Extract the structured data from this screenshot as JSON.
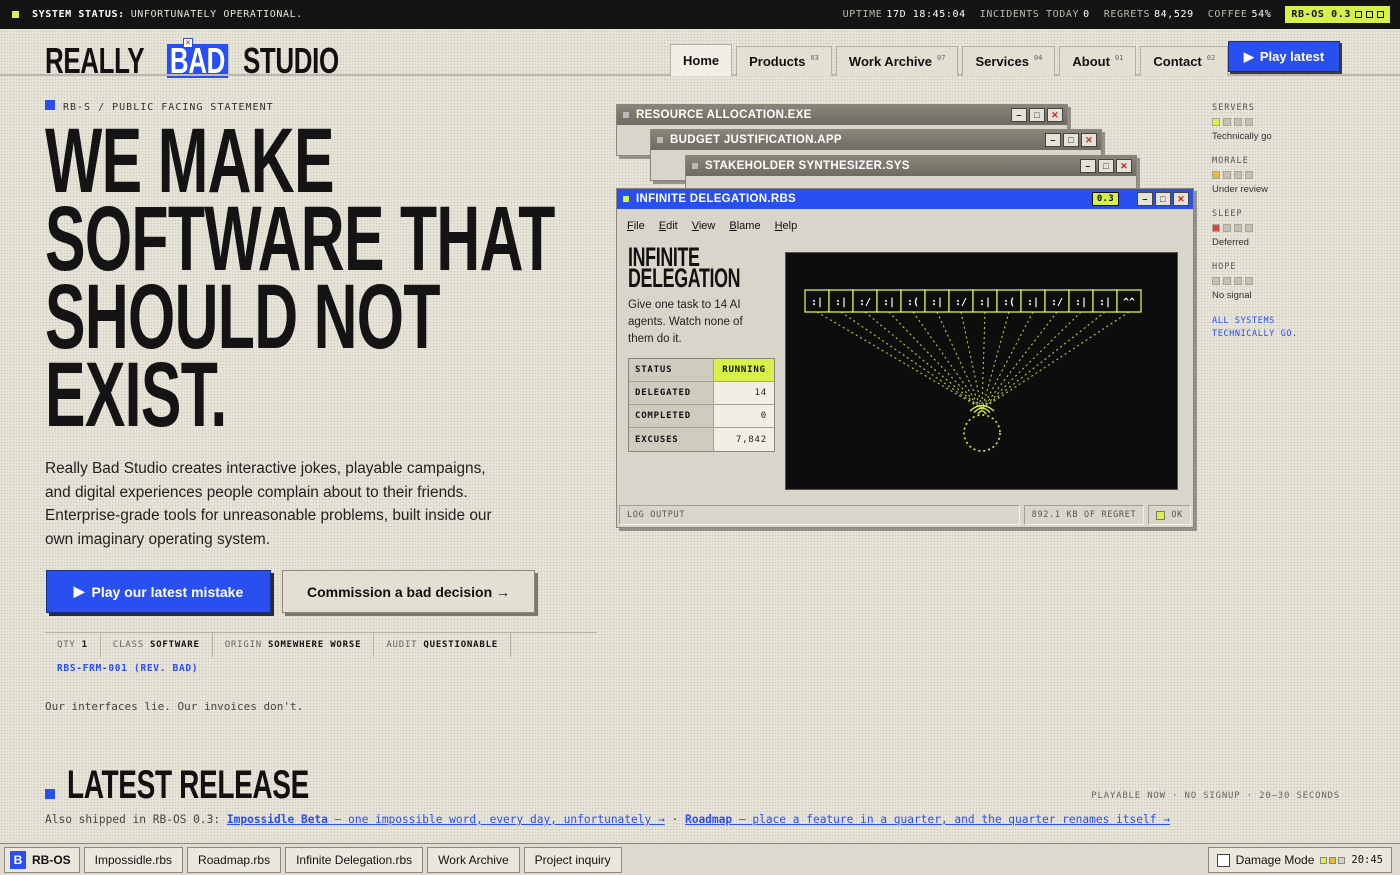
{
  "topbar": {
    "status_label": "SYSTEM STATUS:",
    "status_value": "UNFORTUNATELY OPERATIONAL.",
    "uptime_label": "UPTIME",
    "uptime_value": "17D 18:45:04",
    "incidents_label": "INCIDENTS TODAY",
    "incidents_value": "0",
    "regrets_label": "REGRETS",
    "regrets_value": "84,529",
    "coffee_label": "COFFEE",
    "coffee_value": "54%",
    "os_badge": "RB-OS 0.3"
  },
  "logo": {
    "word1": "REALLY",
    "word2": "BAD",
    "word3": "STUDIO"
  },
  "nav": {
    "tabs": [
      {
        "label": "Home",
        "count": ""
      },
      {
        "label": "Products",
        "count": "03"
      },
      {
        "label": "Work Archive",
        "count": "07"
      },
      {
        "label": "Services",
        "count": "04"
      },
      {
        "label": "About",
        "count": "01"
      },
      {
        "label": "Contact",
        "count": "02"
      }
    ],
    "play_latest": "Play latest"
  },
  "hero": {
    "kicker": "RB-S / PUBLIC FACING STATEMENT",
    "headline": [
      "WE MAKE",
      "SOFTWARE THAT",
      "SHOULD NOT",
      "EXIST."
    ],
    "intro": "Really Bad Studio creates interactive jokes, playable campaigns, and digital experiences people complain about to their friends. Enterprise-grade tools for unreasonable problems, built inside our own imaginary operating system.",
    "primary_cta": "Play our latest mistake",
    "secondary_cta": "Commission a bad decision →",
    "specs": [
      {
        "k": "QTY",
        "v": "1"
      },
      {
        "k": "CLASS",
        "v": "SOFTWARE"
      },
      {
        "k": "ORIGIN",
        "v": "SOMEWHERE WORSE"
      },
      {
        "k": "AUDIT",
        "v": "QUESTIONABLE"
      }
    ],
    "form_code": "RBS-FRM-001 (REV. BAD)",
    "tagline": "Our interfaces lie. Our invoices don't."
  },
  "windows": {
    "back1": "RESOURCE ALLOCATION.EXE",
    "back2": "BUDGET JUSTIFICATION.APP",
    "back3": "STAKEHOLDER SYNTHESIZER.SYS",
    "main_title": "INFINITE DELEGATION.RBS",
    "main_version": "0.3",
    "menu": [
      "File",
      "Edit",
      "View",
      "Blame",
      "Help"
    ],
    "app_title": [
      "INFINITE",
      "DELEGATION"
    ],
    "app_desc": "Give one task to 14 AI agents. Watch none of them do it.",
    "stats": [
      {
        "k": "STATUS",
        "v": "RUNNING"
      },
      {
        "k": "DELEGATED",
        "v": "14"
      },
      {
        "k": "COMPLETED",
        "v": "0"
      },
      {
        "k": "EXCUSES",
        "v": "7,842"
      }
    ],
    "agents": [
      ":|",
      ":|",
      ":/",
      ":|",
      ":(",
      ":|",
      ":/",
      ":|",
      ":(",
      ":|",
      ":/",
      ":|",
      ":|",
      "^^"
    ],
    "log_label": "LOG OUTPUT",
    "size_label": "892.1 KB OF REGRET",
    "ok_label": "OK"
  },
  "rail": {
    "metrics": [
      {
        "label": "SERVERS",
        "sub": "Technically go",
        "level": 1,
        "color": "#d8f04a"
      },
      {
        "label": "MORALE",
        "sub": "Under review",
        "level": 1,
        "color": "#e8b93a"
      },
      {
        "label": "SLEEP",
        "sub": "Deferred",
        "level": 1,
        "color": "#d9453b"
      },
      {
        "label": "HOPE",
        "sub": "No signal",
        "level": 0,
        "color": "#c4c0b4"
      }
    ],
    "footer_line1": "ALL SYSTEMS",
    "footer_line2": "TECHNICALLY GO."
  },
  "latest": {
    "title": "LATEST RELEASE",
    "meta": "PLAYABLE NOW · NO SIGNUP · 20–30 SECONDS",
    "also_prefix": "Also shipped in RB-OS 0.3:",
    "link1_name": "Impossidle Beta",
    "link1_desc": "— one impossible word, every day, unfortunately →",
    "separator": "·",
    "link2_name": "Roadmap",
    "link2_desc": "— place a feature in a quarter, and the quarter renames itself →"
  },
  "taskbar": {
    "start": "RB-OS",
    "start_glyph": "B",
    "items": [
      "Impossidle.rbs",
      "Roadmap.rbs",
      "Infinite Delegation.rbs",
      "Work Archive",
      "Project inquiry"
    ],
    "damage_mode": "Damage Mode",
    "clock": "20:45"
  },
  "colors": {
    "accent": "#2a4ff0",
    "lime": "#d8f04a",
    "ink": "#141414",
    "paper": "#e8e4d9"
  }
}
